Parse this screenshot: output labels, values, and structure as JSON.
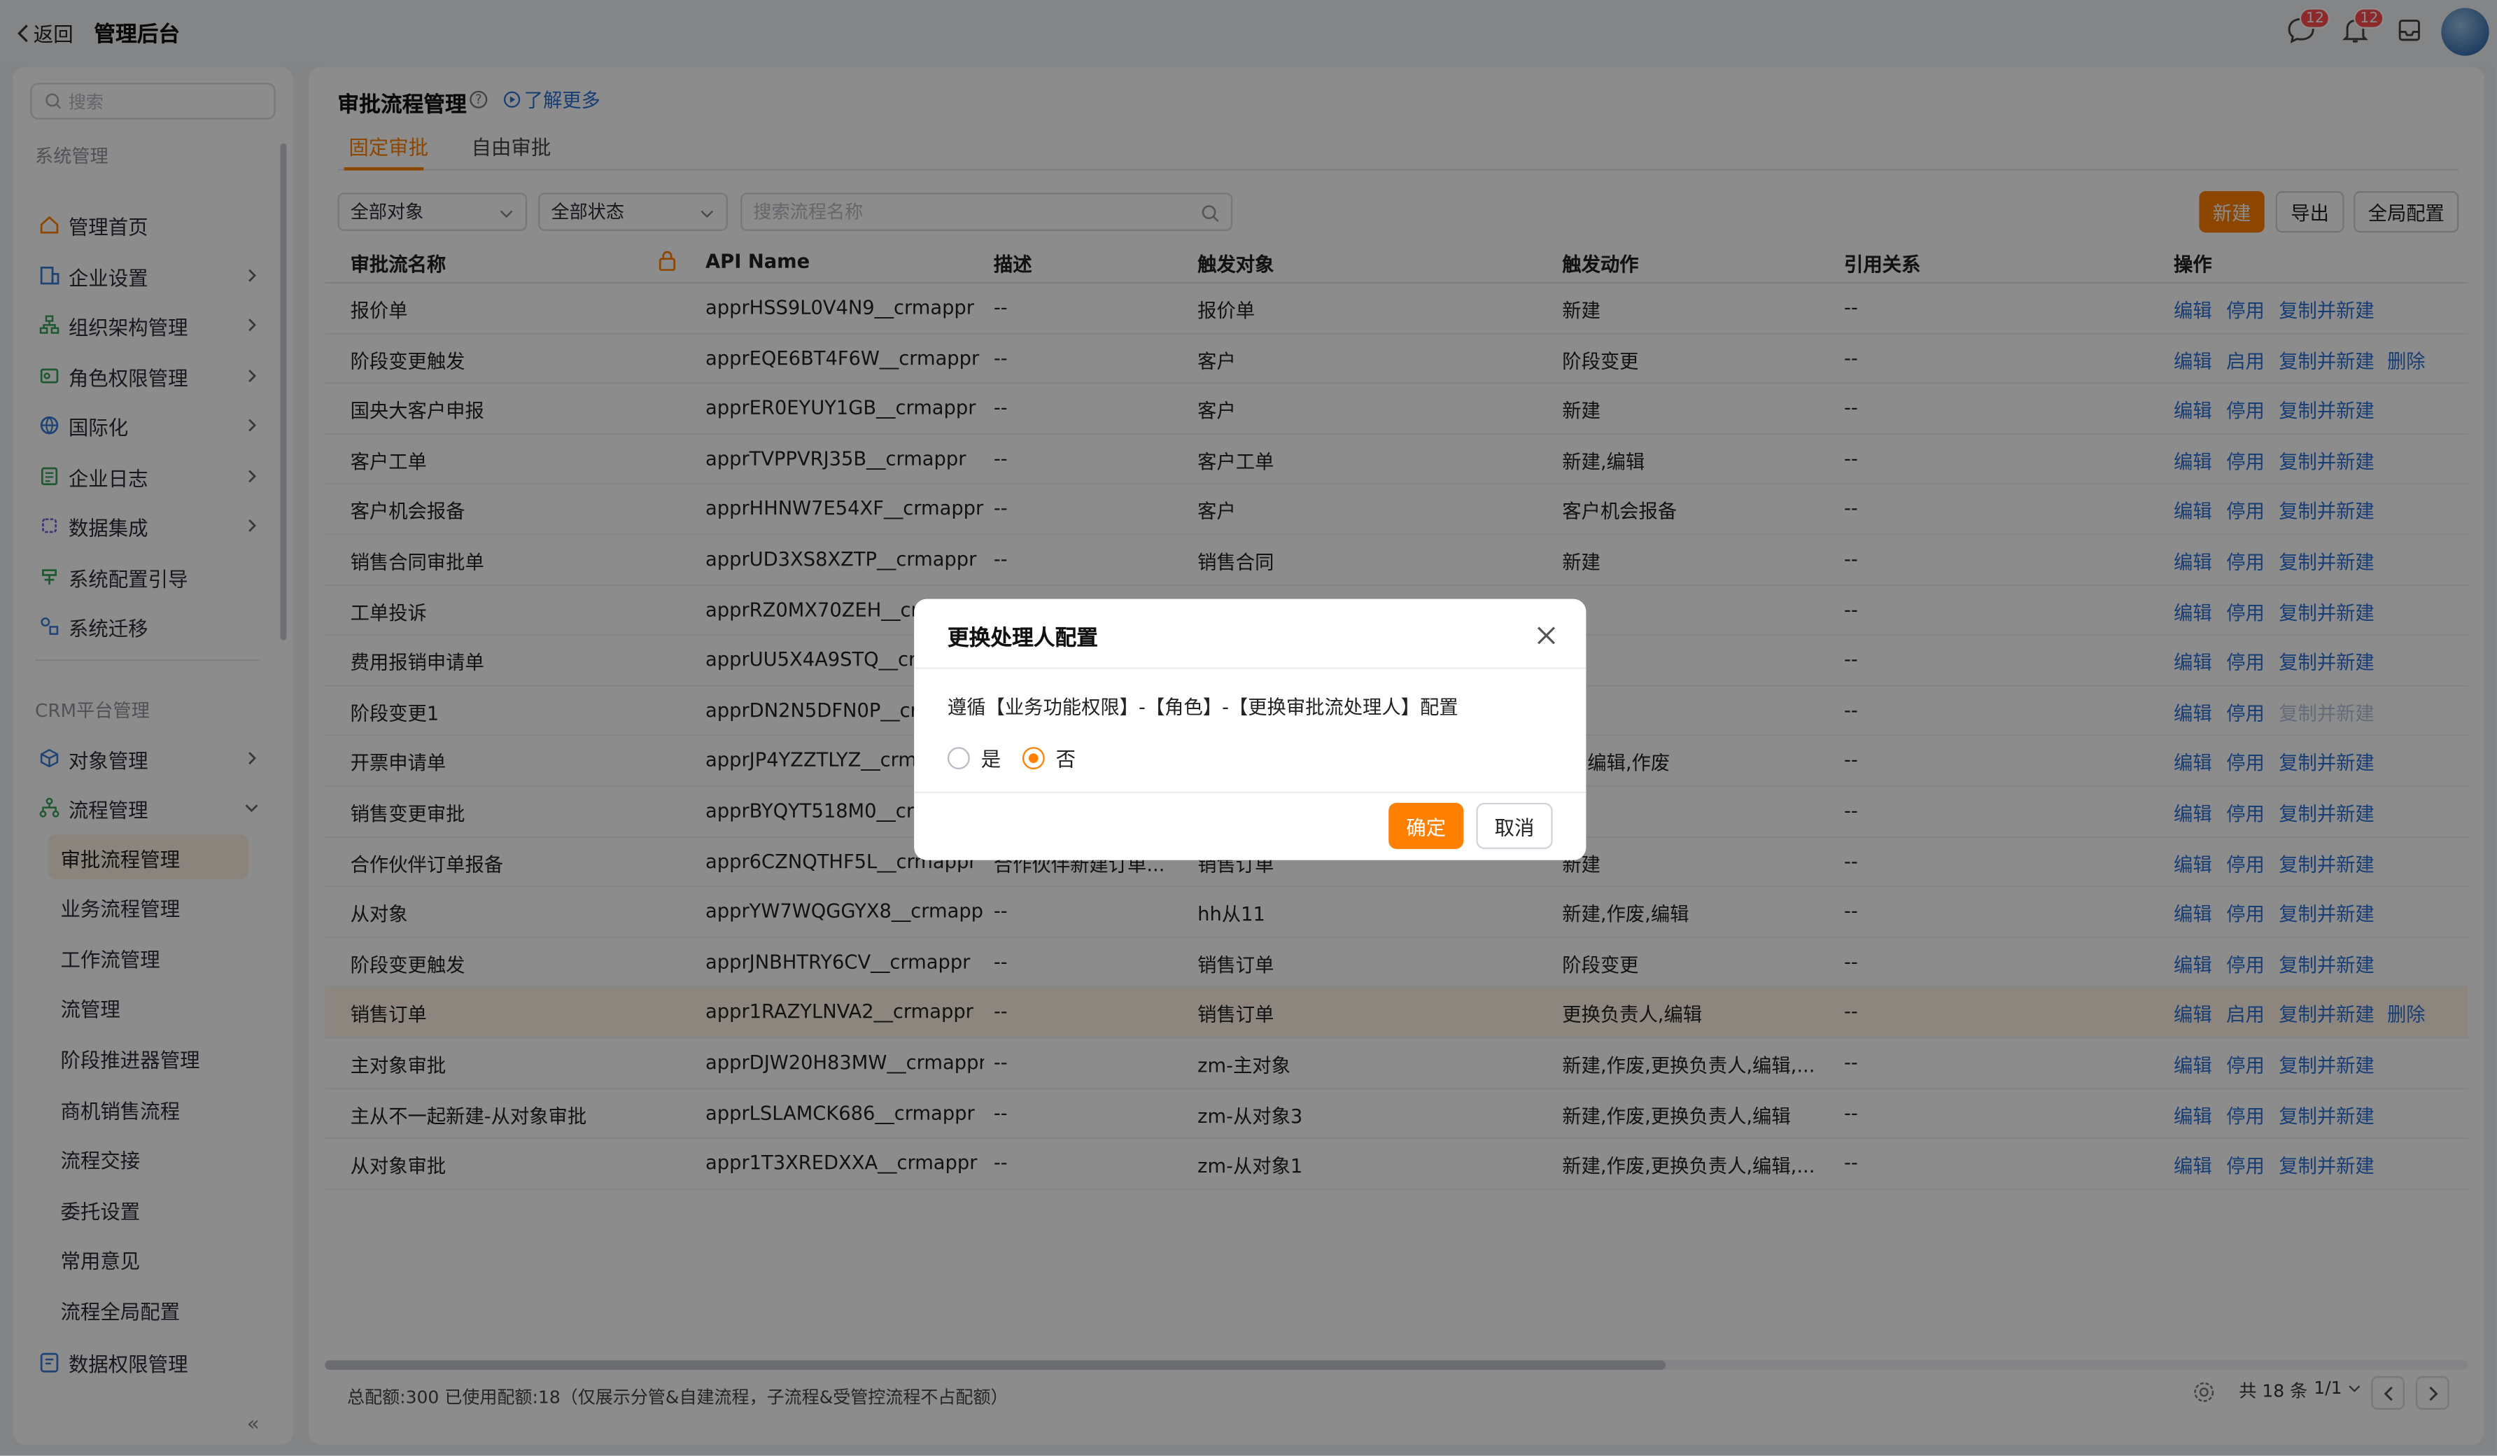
{
  "topbar": {
    "back_label": "返回",
    "app_title": "管理后台",
    "msg_badge": "12",
    "notice_badge": "12"
  },
  "sidebar": {
    "search_placeholder": "搜索",
    "group_system": "系统管理",
    "system_items": [
      {
        "label": "管理首页",
        "icon": "home-icon"
      },
      {
        "label": "企业设置",
        "icon": "building-icon"
      },
      {
        "label": "组织架构管理",
        "icon": "org-icon"
      },
      {
        "label": "角色权限管理",
        "icon": "role-icon"
      },
      {
        "label": "国际化",
        "icon": "globe-icon"
      },
      {
        "label": "企业日志",
        "icon": "log-icon"
      },
      {
        "label": "数据集成",
        "icon": "integration-icon"
      },
      {
        "label": "系统配置引导",
        "icon": "guide-icon"
      },
      {
        "label": "系统迁移",
        "icon": "migrate-icon"
      }
    ],
    "group_crm": "CRM平台管理",
    "crm_items": [
      {
        "label": "对象管理",
        "icon": "cube-icon"
      },
      {
        "label": "流程管理",
        "icon": "flow-icon"
      }
    ],
    "flow_sub_items": [
      "审批流程管理",
      "业务流程管理",
      "工作流管理",
      "流管理",
      "阶段推进器管理",
      "商机销售流程",
      "流程交接",
      "委托设置",
      "常用意见",
      "流程全局配置"
    ],
    "last_item": {
      "label": "数据权限管理",
      "icon": "data-permission-icon"
    }
  },
  "page": {
    "title": "审批流程管理",
    "learn_more": "了解更多",
    "tabs": [
      "固定审批",
      "自由审批"
    ]
  },
  "filters": {
    "object": "全部对象",
    "status": "全部状态",
    "search_placeholder": "搜索流程名称"
  },
  "actions": {
    "new": "新建",
    "export": "导出",
    "global_config": "全局配置"
  },
  "table": {
    "headers": [
      "审批流名称",
      "API Name",
      "描述",
      "触发对象",
      "触发动作",
      "引用关系",
      "操作"
    ],
    "rows": [
      {
        "name": "报价单",
        "api": "apprHSS9L0V4N9__crmappr",
        "desc": "--",
        "obj": "报价单",
        "action": "新建",
        "ref": "--",
        "ops": [
          "编辑",
          "停用",
          "复制并新建"
        ]
      },
      {
        "name": "阶段变更触发",
        "api": "apprEQE6BT4F6W__crmappr",
        "desc": "--",
        "obj": "客户",
        "action": "阶段变更",
        "ref": "--",
        "ops": [
          "编辑",
          "启用",
          "复制并新建",
          "删除"
        ]
      },
      {
        "name": "国央大客户申报",
        "api": "apprER0EYUY1GB__crmappr",
        "desc": "--",
        "obj": "客户",
        "action": "新建",
        "ref": "--",
        "ops": [
          "编辑",
          "停用",
          "复制并新建"
        ]
      },
      {
        "name": "客户工单",
        "api": "apprTVPPVRJ35B__crmappr",
        "desc": "--",
        "obj": "客户工单",
        "action": "新建,编辑",
        "ref": "--",
        "ops": [
          "编辑",
          "停用",
          "复制并新建"
        ]
      },
      {
        "name": "客户机会报备",
        "api": "apprHHNW7E54XF__crmappr",
        "desc": "--",
        "obj": "客户",
        "action": "客户机会报备",
        "ref": "--",
        "ops": [
          "编辑",
          "停用",
          "复制并新建"
        ]
      },
      {
        "name": "销售合同审批单",
        "api": "apprUD3XS8XZTP__crmappr",
        "desc": "--",
        "obj": "销售合同",
        "action": "新建",
        "ref": "--",
        "ops": [
          "编辑",
          "停用",
          "复制并新建"
        ]
      },
      {
        "name": "工单投诉",
        "api": "apprRZ0MX70ZEH__crm",
        "desc": "",
        "obj": "",
        "action": "建",
        "ref": "--",
        "ops": [
          "编辑",
          "停用",
          "复制并新建"
        ]
      },
      {
        "name": "费用报销申请单",
        "api": "apprUU5X4A9STQ__crm",
        "desc": "",
        "obj": "",
        "action": "建",
        "ref": "--",
        "ops": [
          "编辑",
          "停用",
          "复制并新建"
        ]
      },
      {
        "name": "阶段变更1",
        "api": "apprDN2N5DFN0P__crm",
        "desc": "",
        "obj": "",
        "action": "",
        "ref": "--",
        "ops": [
          "编辑",
          "停用",
          "复制并新建"
        ],
        "disabled_copy": true
      },
      {
        "name": "开票申请单",
        "api": "apprJP4YZZTLYZ__crm",
        "desc": "",
        "obj": "",
        "action": "建,编辑,作废",
        "ref": "--",
        "ops": [
          "编辑",
          "停用",
          "复制并新建"
        ]
      },
      {
        "name": "销售变更审批",
        "api": "apprBYQYT518M0__crm",
        "desc": "",
        "obj": "",
        "action": "建",
        "ref": "--",
        "ops": [
          "编辑",
          "停用",
          "复制并新建"
        ]
      },
      {
        "name": "合作伙伴订单报备",
        "api": "appr6CZNQTHF5L__crmappr",
        "desc": "合作伙伴新建订单...",
        "obj": "销售订单",
        "action": "新建",
        "ref": "--",
        "ops": [
          "编辑",
          "停用",
          "复制并新建"
        ]
      },
      {
        "name": "从对象",
        "api": "apprYW7WQGGYX8__crmappr",
        "desc": "--",
        "obj": "hh从11",
        "action": "新建,作废,编辑",
        "ref": "--",
        "ops": [
          "编辑",
          "停用",
          "复制并新建"
        ]
      },
      {
        "name": "阶段变更触发",
        "api": "apprJNBHTRY6CV__crmappr",
        "desc": "--",
        "obj": "销售订单",
        "action": "阶段变更",
        "ref": "--",
        "ops": [
          "编辑",
          "停用",
          "复制并新建"
        ]
      },
      {
        "name": "销售订单",
        "api": "appr1RAZYLNVA2__crmappr",
        "desc": "--",
        "obj": "销售订单",
        "action": "更换负责人,编辑",
        "ref": "--",
        "ops": [
          "编辑",
          "启用",
          "复制并新建",
          "删除"
        ],
        "highlight": true
      },
      {
        "name": "主对象审批",
        "api": "apprDJW20H83MW__crmappr",
        "desc": "--",
        "obj": "zm-主对象",
        "action": "新建,作废,更换负责人,编辑,...",
        "ref": "--",
        "ops": [
          "编辑",
          "停用",
          "复制并新建"
        ]
      },
      {
        "name": "主从不一起新建-从对象审批",
        "api": "apprLSLAMCK686__crmappr",
        "desc": "--",
        "obj": "zm-从对象3",
        "action": "新建,作废,更换负责人,编辑",
        "ref": "--",
        "ops": [
          "编辑",
          "停用",
          "复制并新建"
        ]
      },
      {
        "name": "从对象审批",
        "api": "appr1T3XREDXXA__crmappr",
        "desc": "--",
        "obj": "zm-从对象1",
        "action": "新建,作废,更换负责人,编辑,...",
        "ref": "--",
        "ops": [
          "编辑",
          "停用",
          "复制并新建"
        ]
      }
    ]
  },
  "footer": {
    "quota": "总配额:300 已使用配额:18（仅展示分管&自建流程，子流程&受管控流程不占配额）",
    "total": "共 18 条",
    "page": "1/1"
  },
  "modal": {
    "title": "更换处理人配置",
    "text": "遵循【业务功能权限】-【角色】-【更换审批流处理人】配置",
    "option_yes": "是",
    "option_no": "否",
    "selected": "否",
    "confirm": "确定",
    "cancel": "取消"
  },
  "colors": {
    "accent": "#ff8000",
    "link": "#2a6fd6"
  }
}
